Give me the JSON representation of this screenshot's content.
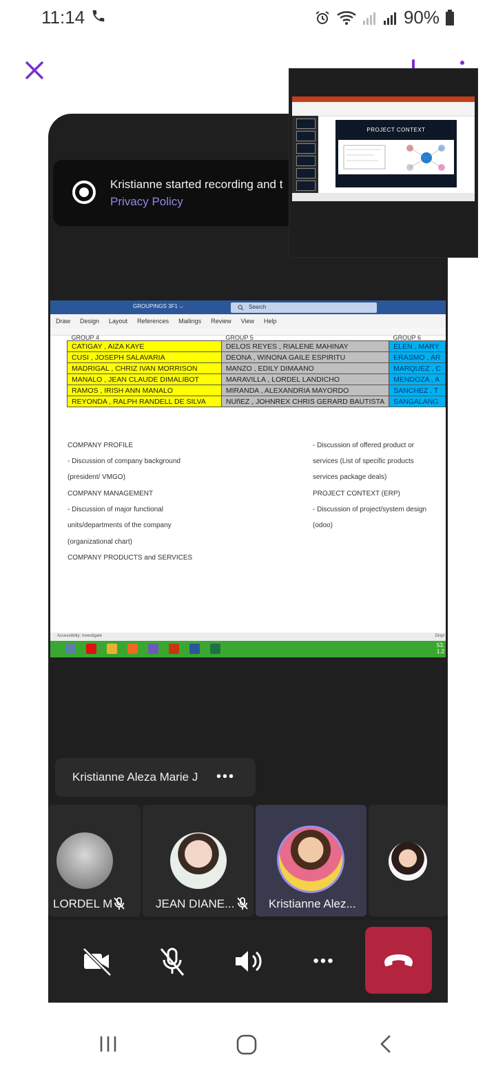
{
  "status_bar": {
    "time": "11:14",
    "battery": "90%"
  },
  "recording_banner": {
    "message": "Kristianne started recording and t",
    "link": "Privacy Policy"
  },
  "presentation": {
    "slide_title": "PROJECT CONTEXT"
  },
  "shared_doc": {
    "window_title": "GROUPINGS 3F1 ⌵",
    "search_placeholder": "Search",
    "menu": [
      "Draw",
      "Design",
      "Layout",
      "References",
      "Mailings",
      "Review",
      "View",
      "Help"
    ],
    "group_headers": [
      "GROUP 4",
      "GROUP 5",
      "GROUP 6"
    ],
    "rows": [
      [
        "CATIGAY , AIZA KAYE",
        "DELOS REYES , RIALENE MAHINAY",
        "ELEN , MARY"
      ],
      [
        "CUSI , JOSEPH SALAVARIA",
        "DEONA , WINONA GAILE ESPIRITU",
        "ERASMO , AR"
      ],
      [
        "MADRIGAL , CHRIZ IVAN MORRISON",
        "MANZO , EDILY DIMAANO",
        "MARQUEZ , C"
      ],
      [
        "MANALO , JEAN CLAUDE DIMALIBOT",
        "MARAVILLA , LORDEL LANDICHO",
        "MENDOZA , A"
      ],
      [
        "RAMOS , IRISH ANN MANALO",
        "MIRANDA , ALEXANDRIA MAYORDO",
        "SANCHEZ , T"
      ],
      [
        "REYONDA , RALPH RANDELL DE SILVA",
        "NUñEZ , JOHNREX CHRIS GERARD BAUTISTA",
        "SANGALANG"
      ]
    ],
    "left_column": [
      "COMPANY PROFILE",
      "- Discussion of company background",
      "(president/ VMGO)",
      "COMPANY MANAGEMENT",
      "- Discussion of major functional",
      "units/departments of the company",
      "(organizational chart)",
      "COMPANY PRODUCTS and SERVICES"
    ],
    "right_column": [
      "- Discussion of offered product or",
      "services (List of specific products",
      "services package deals)",
      "PROJECT CONTEXT (ERP)",
      "- Discussion of project/system design",
      "(odoo)"
    ],
    "status_left": "Accessibility: Investigate",
    "status_right": "Displ",
    "tray_numbers": [
      "53.",
      "1.2"
    ]
  },
  "active_speaker": {
    "name": "Kristianne Aleza Marie J",
    "more": "•••"
  },
  "participants": [
    {
      "name": "LORDEL M",
      "muted": true
    },
    {
      "name": "JEAN DIANE...",
      "muted": true
    },
    {
      "name": "Kristianne Alez...",
      "muted": false,
      "active": true
    },
    {
      "name": "",
      "muted": false
    }
  ],
  "controls": {
    "more": "•••"
  },
  "colors": {
    "accent": "#7b2fd1",
    "end_call": "#b3243f",
    "link": "#8c88e8"
  }
}
